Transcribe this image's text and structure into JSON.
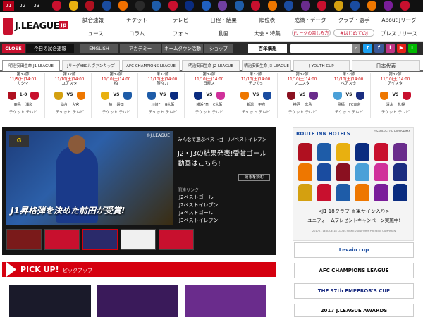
{
  "topbar": {
    "divisions": [
      "J1",
      "J2",
      "J3"
    ],
    "crest_colors": [
      "#c8102e",
      "#e8b010",
      "#b01020",
      "#1a4ca0",
      "#f07000",
      "#2a2a2a",
      "#1e5ca8",
      "#c8102e",
      "#0a2c80",
      "#2060c0",
      "#7040a0",
      "#1e5ca8",
      "#c8102e",
      "#ee7700",
      "#1a4ca0",
      "#6a2c8c",
      "#c8102e",
      "#d4a010",
      "#1a4ca0",
      "#ee7700",
      "#7a1e9a",
      "#c8102e"
    ]
  },
  "header": {
    "logo": "J.LEAGUE",
    "logo_suffix": "jp",
    "nav_row1": [
      "試合速報",
      "チケット",
      "テレビ",
      "日程・結果",
      "順位表",
      "成績・データ",
      "クラブ・選手",
      "About Jリーグ"
    ],
    "nav_row2": [
      "ニュース",
      "コラム",
      "フォト",
      "動画",
      "大会・特集"
    ],
    "pill_labels": [
      "Jリーグの楽しみ方",
      "#はじめてのJ",
      "プレスリリース"
    ]
  },
  "subbar": {
    "closed_label": "CLOSE",
    "today_label": "今日の試合速報",
    "buttons": [
      "ENGLISH",
      "アカデミー",
      "ホームタウン活動",
      "ショップ"
    ],
    "hyakunen": "百年構想",
    "social": [
      "t",
      "f",
      "i",
      "▶",
      "L"
    ],
    "social_colors": [
      "#1da1f2",
      "#3b5998",
      "#c13584",
      "#e62117",
      "#00b900"
    ]
  },
  "competition_tabs": [
    "明治安田生命 J1 LEAGUE",
    "JリーグYBCルヴァンカップ",
    "AFC CHAMPIONS LEAGUE",
    "明治安田生命 J2 LEAGUE",
    "明治安田生命 J3 LEAGUE",
    "J YOUTH CUP",
    "日本代表"
  ],
  "fixtures": [
    {
      "round": "第32節",
      "date": "11/5(日)14:03",
      "venue": "カシマ",
      "score": "1-0",
      "home": "鹿島",
      "away": "浦和",
      "home_color": "#b01020",
      "away_color": "#c8102e",
      "tv": "チケット テレビ"
    },
    {
      "round": "第32節",
      "date": "11/10(土)14:00",
      "venue": "ユアスタ",
      "score": "VS",
      "home": "仙台",
      "away": "大宮",
      "home_color": "#d4a010",
      "away_color": "#ee7700",
      "tv": "チケット テレビ"
    },
    {
      "round": "第32節",
      "date": "11/10(土)14:00",
      "venue": "柏",
      "score": "VS",
      "home": "柏",
      "away": "磐田",
      "home_color": "#e8b010",
      "away_color": "#1e5ca8",
      "tv": "チケット テレビ"
    },
    {
      "round": "第32節",
      "date": "11/10(土)14:00",
      "venue": "等々力",
      "score": "VS",
      "home": "川崎F",
      "away": "G大阪",
      "home_color": "#1e5ca8",
      "away_color": "#0a2c80",
      "tv": "チケット テレビ"
    },
    {
      "round": "第32節",
      "date": "11/10(土)14:00",
      "venue": "日産ス",
      "score": "VS",
      "home": "横浜FM",
      "away": "C大阪",
      "home_color": "#0a2c80",
      "away_color": "#d0309a",
      "tv": "チケット テレビ"
    },
    {
      "round": "第32節",
      "date": "11/10(土)14:00",
      "venue": "デンカS",
      "score": "VS",
      "home": "新潟",
      "away": "甲府",
      "home_color": "#ee7700",
      "away_color": "#1a4ca0",
      "tv": "チケット テレビ"
    },
    {
      "round": "第32節",
      "date": "11/10(土)14:00",
      "venue": "ノエスタ",
      "score": "VS",
      "home": "神戸",
      "away": "広島",
      "home_color": "#8a1020",
      "away_color": "#6a2c8c",
      "tv": "チケット テレビ"
    },
    {
      "round": "第32節",
      "date": "11/10(土)14:00",
      "venue": "ベアスタ",
      "score": "VS",
      "home": "鳥栖",
      "away": "FC東京",
      "home_color": "#4aa0d8",
      "away_color": "#1a2c80",
      "tv": "チケット テレビ"
    },
    {
      "round": "第32節",
      "date": "11/10(土)14:00",
      "venue": "アイスタ",
      "score": "VS",
      "home": "清水",
      "away": "札幌",
      "home_color": "#ee7700",
      "away_color": "#c8102e",
      "tv": "チケット テレビ"
    }
  ],
  "feature": {
    "credit": "©J.LEAGUE",
    "hero_caption": "J1昇格弾を決めた前田が受賞!",
    "section_title": "みんなで選ぶベストゴール/ベストイレブン",
    "headline": "J2・J3の結果発表!受賞ゴール動画はこちら!",
    "more_link": "続きを読む",
    "links_title": "関連リンク",
    "links": [
      "J2ベストゴール",
      "J2ベストイレブン",
      "J3ベストゴール",
      "J3ベストイレブン"
    ]
  },
  "sidebar": {
    "ad_brand": "ROUTE INN HOTELS",
    "ad_copyright": "©SANFRECCE HIROSHIMA",
    "ad_title": "<J1 18クラブ 直筆サイン入り>",
    "ad_subtitle": "ユニフォームプレゼントキャンペーン実施中!",
    "ad_footer": "2017 J1 LEAGUE 18 CLUBS SIGNED UNIFORM PRESENT CAMPAIGN",
    "banners": [
      "Levain cup",
      "AFC CHAMPIONS LEAGUE",
      "THE 97th EMPEROR'S CUP",
      "2017 J.LEAGUE AWARDS"
    ]
  },
  "pickup": {
    "title": "PICK UP!",
    "subtitle": "ピックアップ"
  }
}
